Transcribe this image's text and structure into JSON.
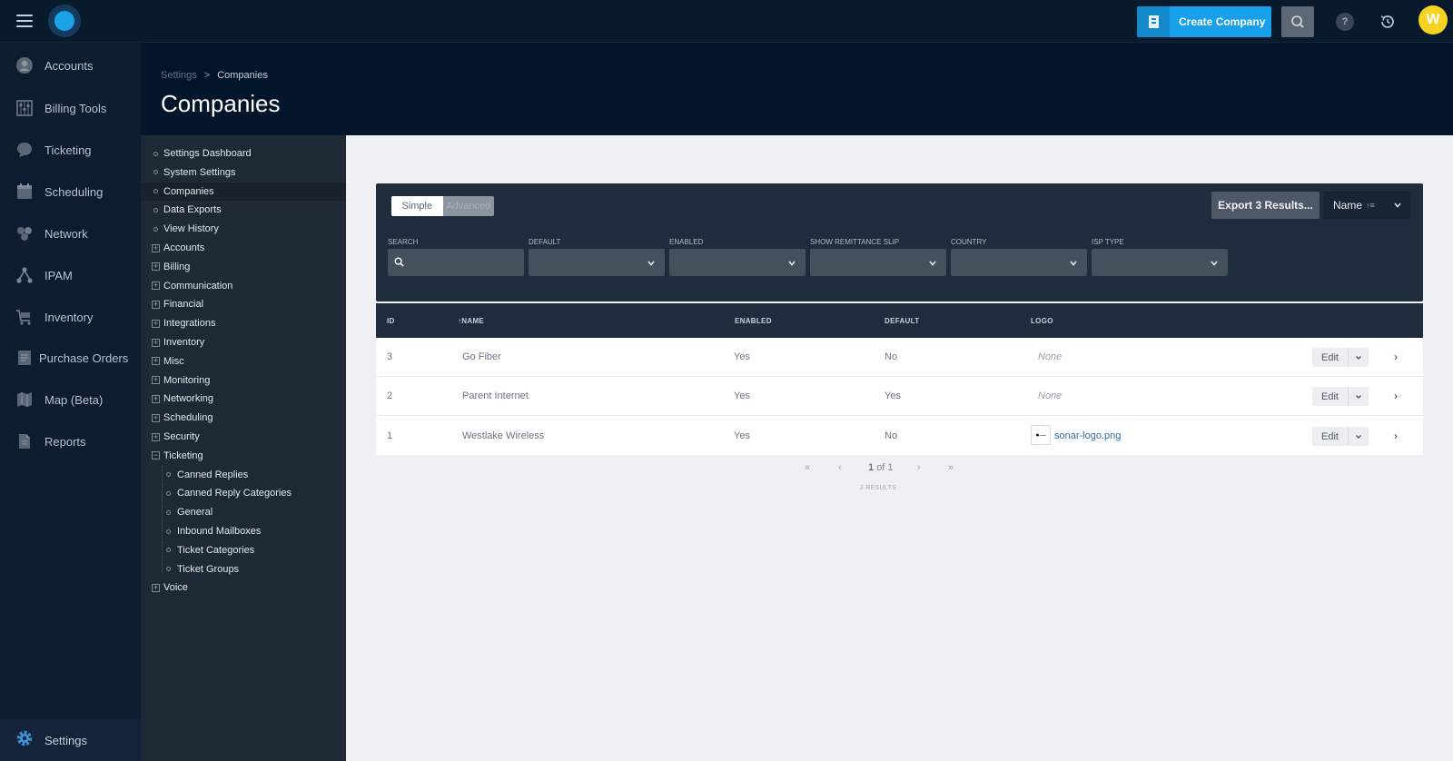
{
  "app": {
    "create_button_label": "Create Company",
    "avatar_initial": "W",
    "help_glyph": "?",
    "colors": {
      "accent": "#18a1ea",
      "nav_bg": "#0e1c2f",
      "header_bg": "#03152a",
      "avatar": "#f5d31e"
    }
  },
  "nav": {
    "items": [
      {
        "label": "Accounts",
        "icon": "user-icon"
      },
      {
        "label": "Billing Tools",
        "icon": "abacus-icon"
      },
      {
        "label": "Ticketing",
        "icon": "chat-bubble-icon"
      },
      {
        "label": "Scheduling",
        "icon": "calendar-icon"
      },
      {
        "label": "Network",
        "icon": "network-icon"
      },
      {
        "label": "IPAM",
        "icon": "hierarchy-icon"
      },
      {
        "label": "Inventory",
        "icon": "cart-icon"
      },
      {
        "label": "Purchase Orders",
        "icon": "receipt-icon"
      },
      {
        "label": "Map (Beta)",
        "icon": "map-icon"
      },
      {
        "label": "Reports",
        "icon": "document-icon"
      }
    ],
    "settings_label": "Settings"
  },
  "header": {
    "breadcrumb": {
      "parent": "Settings",
      "separator": ">",
      "current": "Companies"
    },
    "title": "Companies"
  },
  "tree": {
    "items": [
      {
        "label": "Settings Dashboard",
        "type": "leaf"
      },
      {
        "label": "System Settings",
        "type": "leaf"
      },
      {
        "label": "Companies",
        "type": "leaf",
        "active": true
      },
      {
        "label": "Data Exports",
        "type": "leaf"
      },
      {
        "label": "View History",
        "type": "leaf"
      },
      {
        "label": "Accounts",
        "type": "collapsed"
      },
      {
        "label": "Billing",
        "type": "collapsed"
      },
      {
        "label": "Communication",
        "type": "collapsed"
      },
      {
        "label": "Financial",
        "type": "collapsed"
      },
      {
        "label": "Integrations",
        "type": "collapsed"
      },
      {
        "label": "Inventory",
        "type": "collapsed"
      },
      {
        "label": "Misc",
        "type": "collapsed"
      },
      {
        "label": "Monitoring",
        "type": "collapsed"
      },
      {
        "label": "Networking",
        "type": "collapsed"
      },
      {
        "label": "Scheduling",
        "type": "collapsed"
      },
      {
        "label": "Security",
        "type": "collapsed"
      },
      {
        "label": "Ticketing",
        "type": "expanded"
      },
      {
        "label": "Canned Replies",
        "type": "child"
      },
      {
        "label": "Canned Reply Categories",
        "type": "child"
      },
      {
        "label": "General",
        "type": "child"
      },
      {
        "label": "Inbound Mailboxes",
        "type": "child"
      },
      {
        "label": "Ticket Categories",
        "type": "child"
      },
      {
        "label": "Ticket Groups",
        "type": "child"
      },
      {
        "label": "Voice",
        "type": "collapsed"
      }
    ],
    "collapsed_glyph": "+",
    "expanded_glyph": "−"
  },
  "filters": {
    "mode_simple": "Simple",
    "mode_advanced": "Advanced",
    "export_label": "Export 3 Results...",
    "sort_label": "Name",
    "sort_indicator": "↑≡",
    "fields": [
      {
        "label": "SEARCH",
        "kind": "search",
        "value": ""
      },
      {
        "label": "DEFAULT",
        "kind": "select",
        "value": ""
      },
      {
        "label": "ENABLED",
        "kind": "select",
        "value": ""
      },
      {
        "label": "SHOW REMITTANCE SLIP",
        "kind": "select",
        "value": ""
      },
      {
        "label": "COUNTRY",
        "kind": "select",
        "value": ""
      },
      {
        "label": "ISP TYPE",
        "kind": "select",
        "value": ""
      }
    ]
  },
  "table": {
    "columns": [
      "ID",
      "↑NAME",
      "ENABLED",
      "DEFAULT",
      "LOGO"
    ],
    "rows": [
      {
        "id": "3",
        "name": "Go Fiber",
        "enabled": "Yes",
        "default": "No",
        "logo": "None",
        "has_logo": false
      },
      {
        "id": "2",
        "name": "Parent Internet",
        "enabled": "Yes",
        "default": "Yes",
        "logo": "None",
        "has_logo": false
      },
      {
        "id": "1",
        "name": "Westlake Wireless",
        "enabled": "Yes",
        "default": "No",
        "logo": "sonar-logo.png",
        "has_logo": true,
        "thumb_text": "●—"
      }
    ],
    "edit_label": "Edit"
  },
  "pagination": {
    "first": "«",
    "prev": "‹",
    "page": "1",
    "of": "of 1",
    "next": "›",
    "last": "»",
    "results_label": "3 RESULTS"
  }
}
